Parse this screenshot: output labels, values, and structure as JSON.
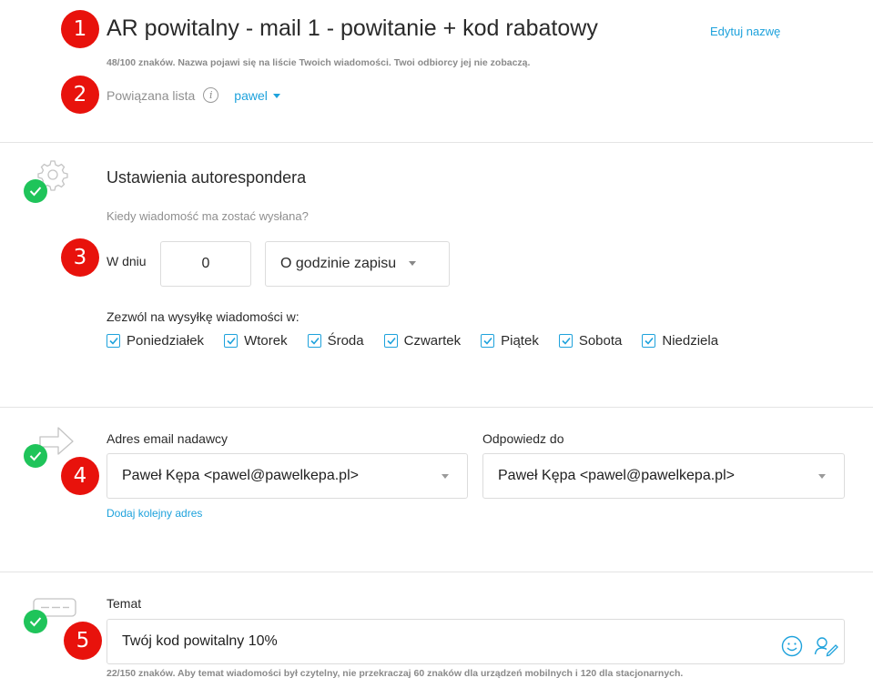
{
  "header": {
    "title": "AR powitalny - mail 1 - powitanie + kod rabatowy",
    "edit_link": "Edytuj nazwę",
    "name_hint": "48/100 znaków. Nazwa pojawi się na liście Twoich wiadomości. Twoi odbiorcy jej nie zobaczą.",
    "list_label": "Powiązana lista",
    "list_value": "pawel"
  },
  "badges": [
    "1",
    "2",
    "3",
    "4",
    "5"
  ],
  "autoresponder": {
    "title": "Ustawienia autorespondera",
    "question": "Kiedy wiadomość ma zostać wysłana?",
    "day_label": "W dniu",
    "day_value": "0",
    "time_option": "O godzinie zapisu",
    "allow_label": "Zezwól na wysyłkę wiadomości w:",
    "days": [
      {
        "label": "Poniedziałek",
        "checked": true
      },
      {
        "label": "Wtorek",
        "checked": true
      },
      {
        "label": "Środa",
        "checked": true
      },
      {
        "label": "Czwartek",
        "checked": true
      },
      {
        "label": "Piątek",
        "checked": true
      },
      {
        "label": "Sobota",
        "checked": true
      },
      {
        "label": "Niedziela",
        "checked": true
      }
    ]
  },
  "sender": {
    "from_label": "Adres email nadawcy",
    "from_value": "Paweł Kępa <pawel@pawelkepa.pl>",
    "reply_label": "Odpowiedz do",
    "reply_value": "Paweł Kępa <pawel@pawelkepa.pl>",
    "add_link": "Dodaj kolejny adres"
  },
  "subject": {
    "label": "Temat",
    "value": "Twój kod powitalny 10%",
    "hint": "22/150 znaków. Aby temat wiadomości był czytelny, nie przekraczaj 60 znaków dla urządzeń mobilnych i 120 dla stacjonarnych."
  },
  "colors": {
    "accent": "#1ea2dc",
    "success": "#1fc45a",
    "badge": "#e8120c"
  },
  "icons": [
    "info-icon",
    "gear-icon",
    "arrow-right-icon",
    "subject-field-icon",
    "check-icon",
    "smiley-icon",
    "personalize-icon",
    "chevron-down-icon"
  ]
}
